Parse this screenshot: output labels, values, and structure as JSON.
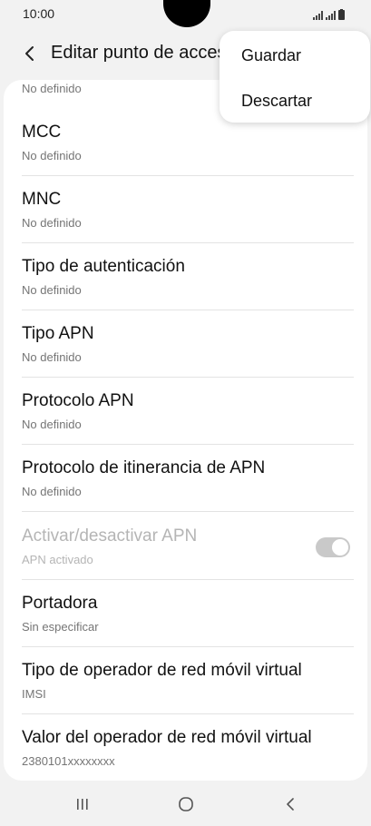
{
  "status_bar": {
    "time": "10:00"
  },
  "app_bar": {
    "title": "Editar punto de acceso"
  },
  "list": {
    "partial_subtitle": "No definido",
    "items": [
      {
        "title": "MCC",
        "subtitle": "No definido"
      },
      {
        "title": "MNC",
        "subtitle": "No definido"
      },
      {
        "title": "Tipo de autenticación",
        "subtitle": "No definido"
      },
      {
        "title": "Tipo APN",
        "subtitle": "No definido"
      },
      {
        "title": "Protocolo APN",
        "subtitle": "No definido"
      },
      {
        "title": "Protocolo de itinerancia de APN",
        "subtitle": "No definido"
      },
      {
        "title": "Activar/desactivar APN",
        "subtitle": "APN activado",
        "toggle": true,
        "disabled": true
      },
      {
        "title": "Portadora",
        "subtitle": "Sin especificar"
      },
      {
        "title": "Tipo de operador de red móvil virtual",
        "subtitle": "IMSI"
      },
      {
        "title": "Valor del operador de red móvil virtual",
        "subtitle": "2380101xxxxxxxx"
      }
    ]
  },
  "menu": {
    "save_label": "Guardar",
    "discard_label": "Descartar"
  },
  "nav_bar": {
    "icons": [
      "recents-icon",
      "home-icon",
      "back-icon"
    ]
  },
  "colors": {
    "background": "#f2f2f2",
    "card": "#ffffff",
    "divider": "#e3e3e3",
    "secondary_text": "#757575"
  }
}
